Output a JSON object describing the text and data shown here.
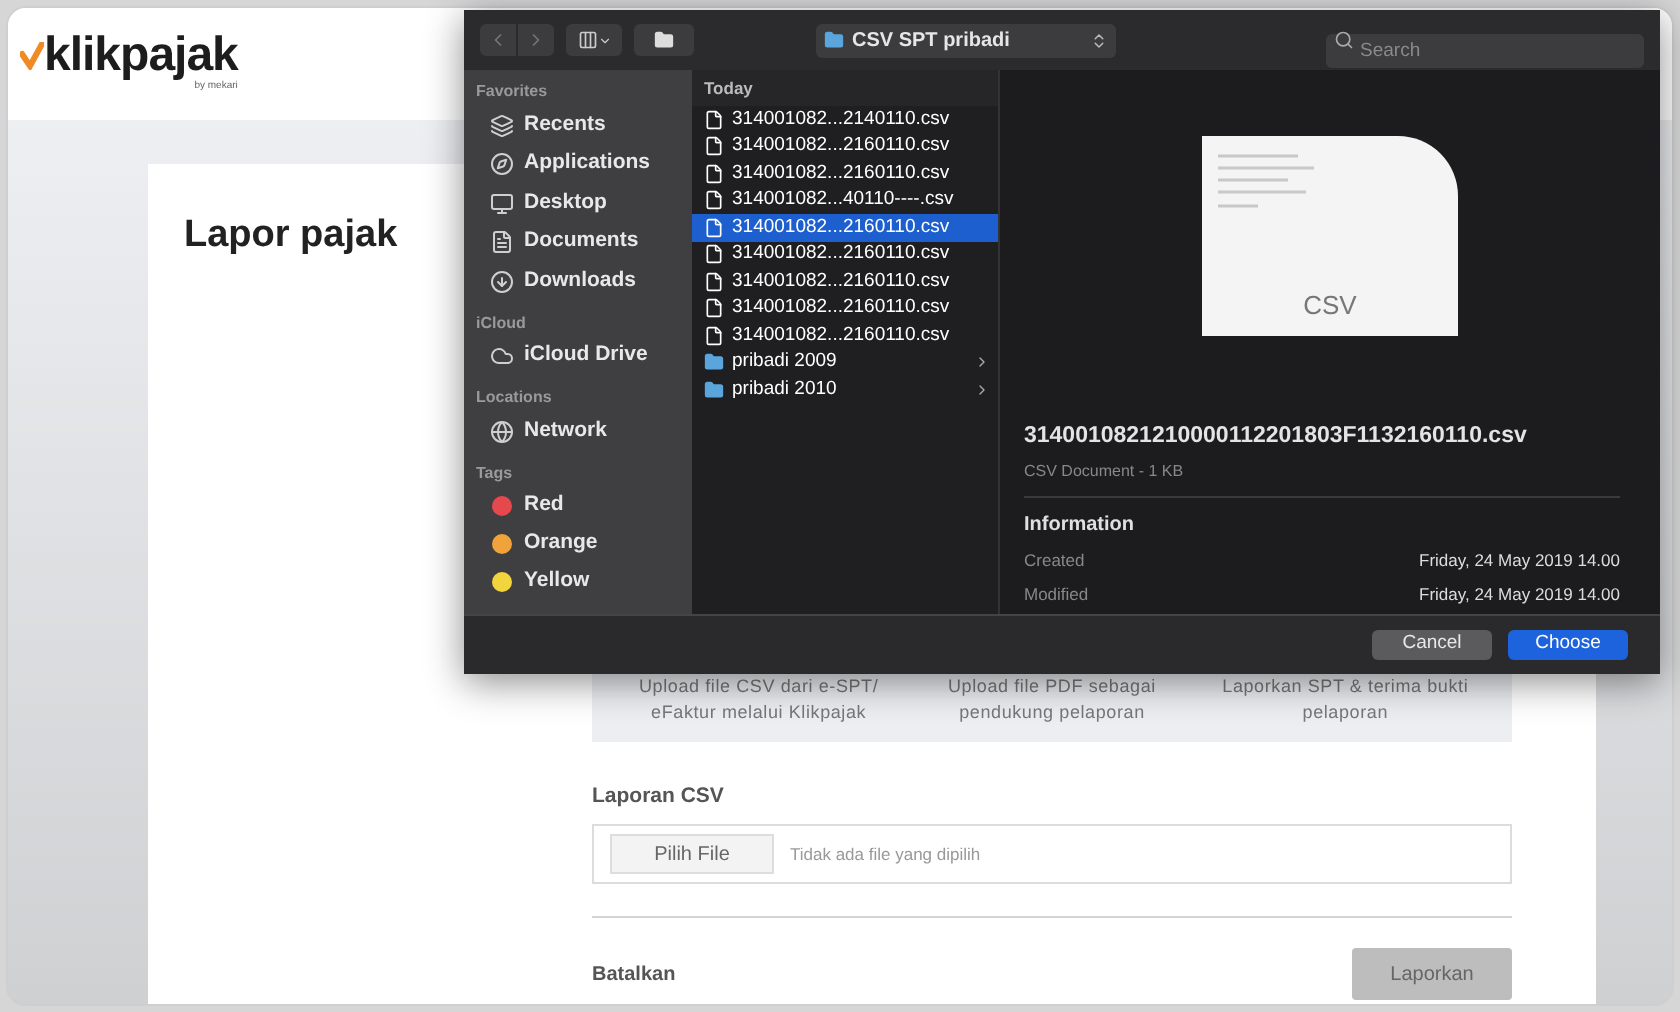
{
  "app": {
    "logo": {
      "name": "klikpajak",
      "tagline": "by mekari"
    },
    "page_title": "Lapor pajak",
    "steps": [
      "Upload file CSV dari e-SPT/ eFaktur melalui Klikpajak",
      "Upload file PDF sebagai pendukung pelaporan",
      "Laporkan SPT & terima bukti pelaporan"
    ],
    "csv_section": {
      "label": "Laporan CSV",
      "button": "Pilih File",
      "status": "Tidak ada file yang dipilih"
    },
    "footer": {
      "cancel": "Batalkan",
      "submit": "Laporkan"
    }
  },
  "file_dialog": {
    "location": "CSV SPT pribadi",
    "search": {
      "placeholder": "Search"
    },
    "sidebar": [
      {
        "section": "Favorites",
        "items": [
          {
            "kind": "place",
            "label": "Recents"
          },
          {
            "kind": "place",
            "label": "Applications"
          },
          {
            "kind": "place",
            "label": "Desktop"
          },
          {
            "kind": "place",
            "label": "Documents"
          },
          {
            "kind": "place",
            "label": "Downloads"
          }
        ]
      },
      {
        "section": "iCloud",
        "items": [
          {
            "kind": "place",
            "label": "iCloud Drive"
          }
        ]
      },
      {
        "section": "Locations",
        "items": [
          {
            "kind": "place",
            "label": "Network"
          }
        ]
      },
      {
        "section": "Tags",
        "items": [
          {
            "kind": "tag",
            "label": "Red",
            "color": "#e5484d"
          },
          {
            "kind": "tag",
            "label": "Orange",
            "color": "#f0a33a"
          },
          {
            "kind": "tag",
            "label": "Yellow",
            "color": "#f2d53c"
          }
        ]
      }
    ],
    "column_header": "Today",
    "files": [
      {
        "kind": "file",
        "name": "314001082...2140110.csv",
        "selected": false
      },
      {
        "kind": "file",
        "name": "314001082...2160110.csv",
        "selected": false
      },
      {
        "kind": "file",
        "name": "314001082...2160110.csv",
        "selected": false
      },
      {
        "kind": "file",
        "name": "314001082...40110----.csv",
        "selected": false
      },
      {
        "kind": "file",
        "name": "314001082...2160110.csv",
        "selected": true
      },
      {
        "kind": "file",
        "name": "314001082...2160110.csv",
        "selected": false
      },
      {
        "kind": "file",
        "name": "314001082...2160110.csv",
        "selected": false
      },
      {
        "kind": "file",
        "name": "314001082...2160110.csv",
        "selected": false
      },
      {
        "kind": "file",
        "name": "314001082...2160110.csv",
        "selected": false
      },
      {
        "kind": "folder",
        "name": "pribadi 2009",
        "selected": false
      },
      {
        "kind": "folder",
        "name": "pribadi 2010",
        "selected": false
      }
    ],
    "preview": {
      "badge": "CSV",
      "filename": "3140010821210000112201803F1132160110.csv",
      "meta": "CSV Document - 1 KB",
      "info_title": "Information",
      "rows": [
        {
          "label": "Created",
          "value": "Friday, 24 May 2019 14.00"
        },
        {
          "label": "Modified",
          "value": "Friday, 24 May 2019 14.00"
        }
      ]
    },
    "buttons": {
      "cancel": "Cancel",
      "choose": "Choose"
    }
  }
}
